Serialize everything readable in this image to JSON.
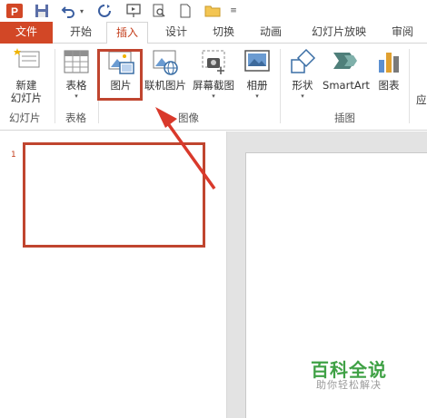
{
  "tabs": [
    {
      "label": "文件"
    },
    {
      "label": "开始"
    },
    {
      "label": "插入"
    },
    {
      "label": "设计"
    },
    {
      "label": "切换"
    },
    {
      "label": "动画"
    },
    {
      "label": "幻灯片放映"
    },
    {
      "label": "审阅"
    }
  ],
  "ribbon": {
    "new_slide": {
      "line1": "新建",
      "line2": "幻灯片"
    },
    "table": "表格",
    "picture": "图片",
    "online_picture": "联机图片",
    "screenshot": "屏幕截图",
    "album": "相册",
    "shapes": "形状",
    "smartart": "SmartArt",
    "chart": "图表",
    "more": "应",
    "groups": {
      "slides": "幻灯片",
      "tables": "表格",
      "images": "图像",
      "illustrations": "插图"
    }
  },
  "slide_pane": {
    "slide_number": "1"
  },
  "watermark": {
    "title": "百科全说",
    "subtitle": "助你轻松解决"
  },
  "colors": {
    "accent": "#d24726",
    "annotation": "#c0452f",
    "watermark": "#3fa145"
  }
}
